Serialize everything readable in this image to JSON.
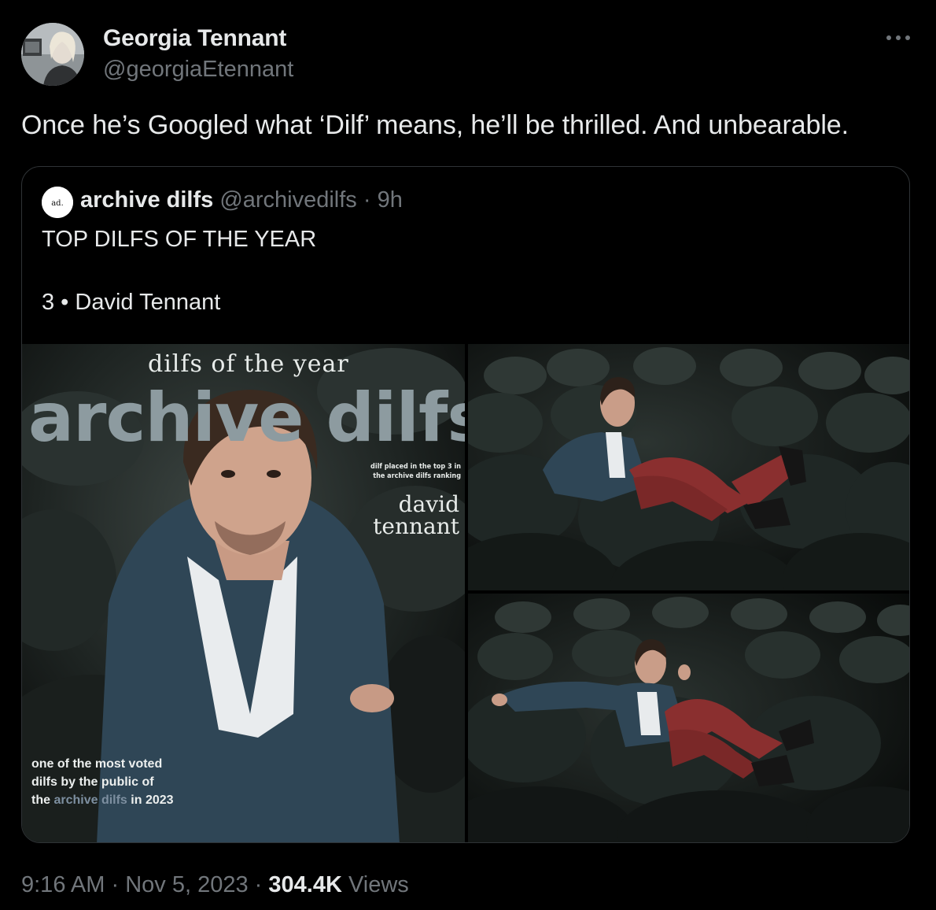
{
  "author": {
    "name": "Georgia Tennant",
    "handle": "@georgiaEtennant"
  },
  "tweet": {
    "text": "Once he’s Googled what ‘Dilf’ means, he’ll be thrilled. And unbearable."
  },
  "quoted_tweet": {
    "name": "archive dilfs",
    "handle": "@archivedilfs",
    "separator": "·",
    "time_ago": "9h",
    "line1": "TOP DILFS OF THE YEAR",
    "line2": "3 • David Tennant",
    "avatar_icon": "archive-dilfs-logo-icon",
    "media": {
      "main_image": {
        "title": "dilfs of the year",
        "brand": "archive dilfs",
        "placed_line1": "dilf placed in the top 3 in",
        "placed_line2": "the archive dilfs ranking",
        "person_line1": "david",
        "person_line2": "tennant",
        "voted_line1": "one of the most voted",
        "voted_line2": "dilfs by the public of",
        "voted_prefix": "the ",
        "voted_highlight": "archive dilfs",
        "voted_suffix": " in 2023"
      }
    }
  },
  "meta": {
    "time": "9:16 AM",
    "separator": "·",
    "date": "Nov 5, 2023",
    "views_count": "304.4K",
    "views_label": "Views"
  },
  "icons": {
    "more": "more-horizontal-icon"
  },
  "colors": {
    "background": "#000000",
    "text_primary": "#e7e9ea",
    "text_secondary": "#71767b",
    "border": "#2f3336"
  }
}
